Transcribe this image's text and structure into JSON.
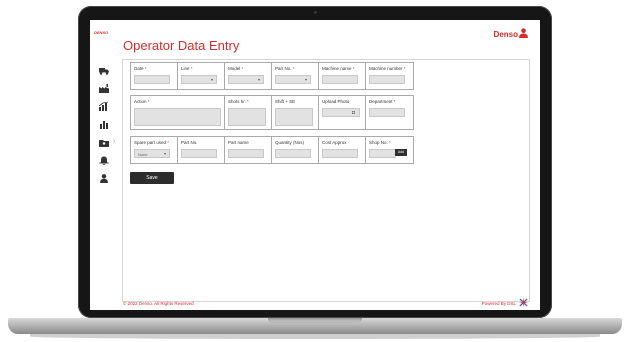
{
  "app": {
    "logo_text": "DENSO",
    "brand": "Denso",
    "title": "Operator Data Entry",
    "colors": {
      "accent": "#d92b2b",
      "button": "#2c2c2c",
      "field": "#e2e2e2"
    }
  },
  "sidebar": {
    "items": [
      {
        "icon": "truck-icon"
      },
      {
        "icon": "factory-icon"
      },
      {
        "icon": "chart-up-icon"
      },
      {
        "icon": "bar-chart-icon"
      },
      {
        "icon": "folder-user-icon"
      },
      {
        "icon": "bell-icon"
      },
      {
        "icon": "person-icon"
      }
    ]
  },
  "form": {
    "row1": {
      "date_label": "Date",
      "date_value": "",
      "line_label": "Line",
      "model_label": "Model",
      "part_no_label": "Part No.",
      "machine_name_label": "Machine name",
      "machine_number_label": "Machine number"
    },
    "row2": {
      "action_label": "Action",
      "shots_label": "Shots hr.",
      "shift_label": "Shift + SE",
      "upload_photo_label": "Upload Photo",
      "department_label": "Department"
    },
    "row3": {
      "spare_parts_label": "Spare part used",
      "spare_parts_value": "None",
      "part_no_label": "Part No.",
      "part_name_label": "Part name",
      "quantity_label": "Quantity (Nos)",
      "cost_label": "Cost Approx",
      "shop_no_label": "Shop No.",
      "add_label": "Add"
    },
    "save_label": "Save"
  },
  "footer": {
    "copyright": "© 2022 Denso. All Rights Reserved",
    "powered": "Powered By DSL"
  }
}
